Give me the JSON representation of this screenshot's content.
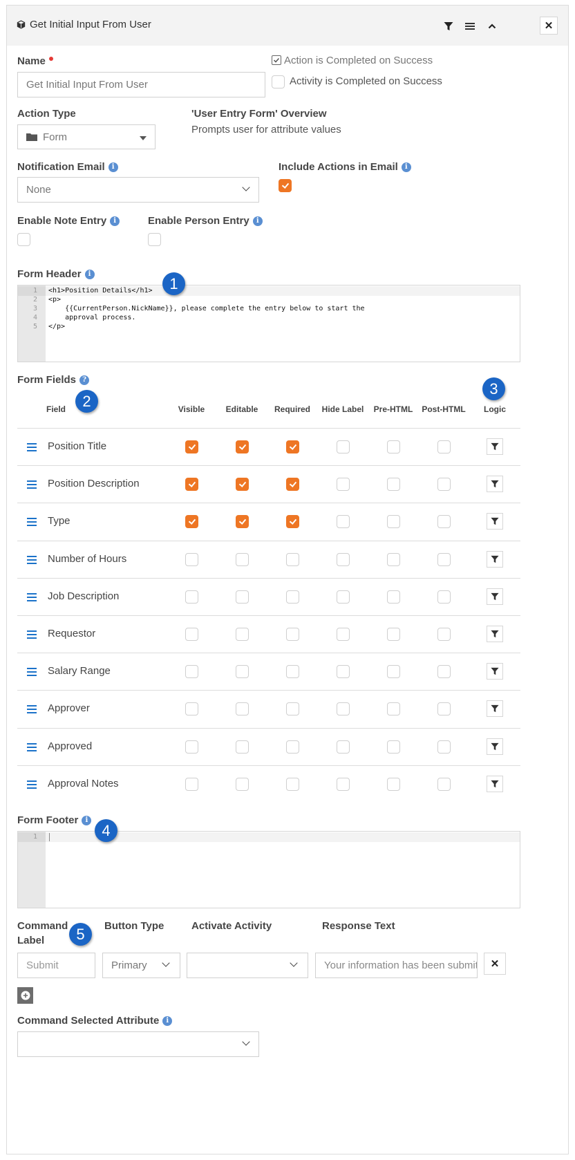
{
  "panel": {
    "title": "Get Initial Input From User",
    "header_icons": [
      "filter-icon",
      "hamburger-menu-icon",
      "chevron-up-icon",
      "close-icon"
    ],
    "close_label": "✕"
  },
  "name": {
    "label": "Name",
    "value": "Get Initial Input From User"
  },
  "action_completed": {
    "label": "Action is Completed on Success",
    "checked": true
  },
  "activity_completed": {
    "label": "Activity is Completed on Success",
    "checked": false
  },
  "action_type": {
    "label": "Action Type",
    "value": "Form"
  },
  "overview": {
    "title": "'User Entry Form' Overview",
    "description": "Prompts user for attribute values"
  },
  "notification_email": {
    "label": "Notification Email",
    "value": "None"
  },
  "include_actions": {
    "label": "Include Actions in Email",
    "checked": true
  },
  "enable_note": {
    "label": "Enable Note Entry",
    "checked": false
  },
  "enable_person": {
    "label": "Enable Person Entry",
    "checked": false
  },
  "form_header": {
    "label": "Form Header",
    "lines": [
      {
        "n": "1",
        "text": "<h1>Position Details</h1>"
      },
      {
        "n": "2",
        "text": "<p>"
      },
      {
        "n": "3",
        "text": "    {{CurrentPerson.NickName}}, please complete the entry below to start the"
      },
      {
        "n": "4",
        "text": "    approval process."
      },
      {
        "n": "5",
        "text": "</p>"
      }
    ]
  },
  "form_fields": {
    "label": "Form Fields",
    "columns": [
      "Field",
      "Visible",
      "Editable",
      "Required",
      "Hide Label",
      "Pre-HTML",
      "Post-HTML",
      "Logic"
    ],
    "rows": [
      {
        "name": "Position Title",
        "visible": true,
        "editable": true,
        "required": true,
        "hide_label": false,
        "pre_html": false,
        "post_html": false
      },
      {
        "name": "Position Description",
        "visible": true,
        "editable": true,
        "required": true,
        "hide_label": false,
        "pre_html": false,
        "post_html": false
      },
      {
        "name": "Type",
        "visible": true,
        "editable": true,
        "required": true,
        "hide_label": false,
        "pre_html": false,
        "post_html": false
      },
      {
        "name": "Number of Hours",
        "visible": false,
        "editable": false,
        "required": false,
        "hide_label": false,
        "pre_html": false,
        "post_html": false
      },
      {
        "name": "Job Description",
        "visible": false,
        "editable": false,
        "required": false,
        "hide_label": false,
        "pre_html": false,
        "post_html": false
      },
      {
        "name": "Requestor",
        "visible": false,
        "editable": false,
        "required": false,
        "hide_label": false,
        "pre_html": false,
        "post_html": false
      },
      {
        "name": "Salary Range",
        "visible": false,
        "editable": false,
        "required": false,
        "hide_label": false,
        "pre_html": false,
        "post_html": false
      },
      {
        "name": "Approver",
        "visible": false,
        "editable": false,
        "required": false,
        "hide_label": false,
        "pre_html": false,
        "post_html": false
      },
      {
        "name": "Approved",
        "visible": false,
        "editable": false,
        "required": false,
        "hide_label": false,
        "pre_html": false,
        "post_html": false
      },
      {
        "name": "Approval Notes",
        "visible": false,
        "editable": false,
        "required": false,
        "hide_label": false,
        "pre_html": false,
        "post_html": false
      }
    ]
  },
  "form_footer": {
    "label": "Form Footer",
    "lines": [
      {
        "n": "1",
        "text": ""
      }
    ]
  },
  "commands": {
    "headers": {
      "command_label_1": "Command",
      "command_label_2": "Label",
      "button_type": "Button Type",
      "activate_activity": "Activate Activity",
      "response_text": "Response Text"
    },
    "row": {
      "command_label_placeholder": "Submit",
      "button_type": "Primary",
      "activate_activity": "",
      "response_text_placeholder": "Your information has been submitted successfully."
    },
    "remove_label": "✕"
  },
  "command_selected_attribute": {
    "label": "Command Selected Attribute",
    "value": ""
  },
  "callouts": [
    "1",
    "2",
    "3",
    "4",
    "5"
  ],
  "colors": {
    "accent_orange": "#ee7624",
    "callout_blue": "#1b65c5",
    "info_blue": "#5a8fd2",
    "drag_blue": "#1b72c9"
  }
}
